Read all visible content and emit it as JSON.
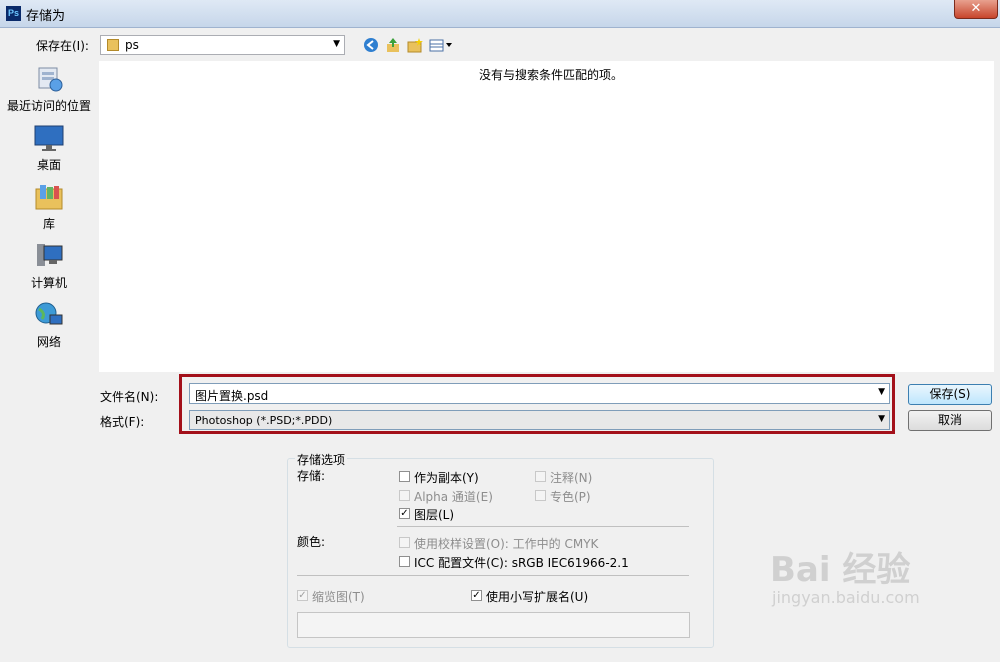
{
  "window": {
    "title": "存储为",
    "app_icon": "Ps",
    "close": "✕"
  },
  "toolbar": {
    "lookin_label": "保存在(I):",
    "lookin_value": "ps"
  },
  "places": [
    {
      "label": "最近访问的位置",
      "icon": "recent-places-icon"
    },
    {
      "label": "桌面",
      "icon": "desktop-icon"
    },
    {
      "label": "库",
      "icon": "libraries-icon"
    },
    {
      "label": "计算机",
      "icon": "computer-icon"
    },
    {
      "label": "网络",
      "icon": "network-icon"
    }
  ],
  "filelist": {
    "empty_message": "没有与搜索条件匹配的项。"
  },
  "form": {
    "filename_label": "文件名(N):",
    "filename_value": "图片置换.psd",
    "format_label": "格式(F):",
    "format_value": "Photoshop (*.PSD;*.PDD)",
    "save_label": "保存(S)",
    "cancel_label": "取消"
  },
  "options": {
    "title": "存储选项",
    "save_label": "存储:",
    "as_copy": {
      "label": "作为副本(Y)",
      "checked": false,
      "enabled": true
    },
    "notes": {
      "label": "注释(N)",
      "checked": false,
      "enabled": false
    },
    "alpha": {
      "label": "Alpha 通道(E)",
      "checked": false,
      "enabled": false
    },
    "spot": {
      "label": "专色(P)",
      "checked": false,
      "enabled": false
    },
    "layers": {
      "label": "图层(L)",
      "checked": true,
      "enabled": true
    },
    "color_label": "颜色:",
    "proof": {
      "label": "使用校样设置(O):  工作中的 CMYK",
      "checked": false,
      "enabled": false
    },
    "icc": {
      "label": "ICC 配置文件(C):  sRGB IEC61966-2.1",
      "checked": false,
      "enabled": true
    },
    "thumbnail": {
      "label": "缩览图(T)",
      "checked": true,
      "enabled": false
    },
    "lowercase": {
      "label": "使用小写扩展名(U)",
      "checked": true,
      "enabled": true
    }
  },
  "watermark": {
    "text": "Bai 经验",
    "sub": "jingyan.baidu.com"
  },
  "colors": {
    "highlight": "#a3101a",
    "titlebar": "#c6d6ea"
  }
}
